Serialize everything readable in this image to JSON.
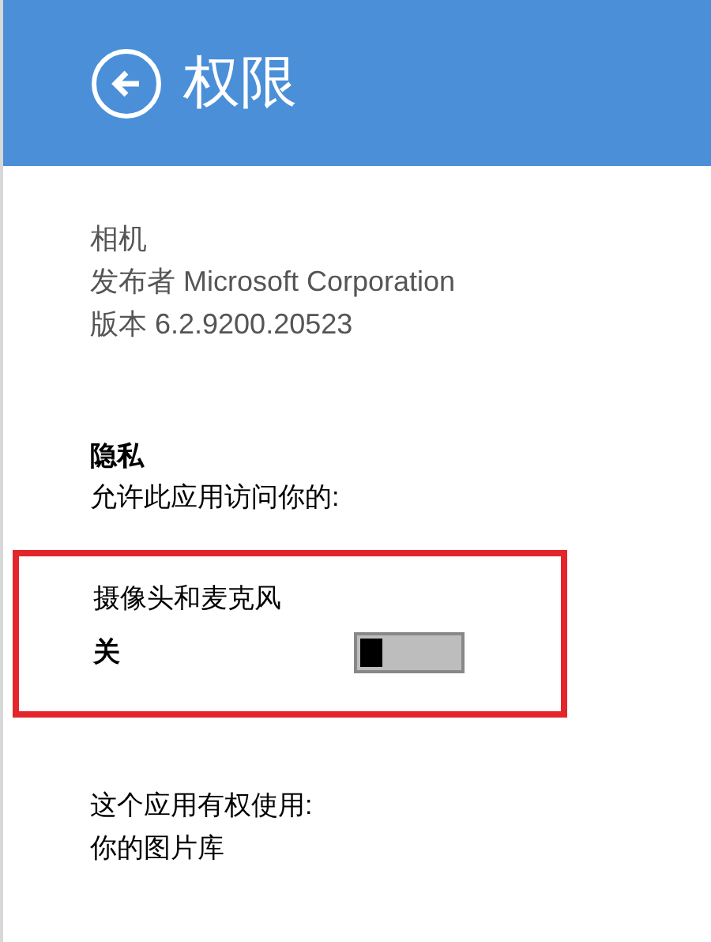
{
  "header": {
    "title": "权限"
  },
  "app": {
    "name": "相机",
    "publisher": "发布者 Microsoft Corporation",
    "version": "版本 6.2.9200.20523"
  },
  "privacy": {
    "heading": "隐私",
    "description": "允许此应用访问你的:"
  },
  "permission": {
    "highlighted": true,
    "label": "摄像头和麦克风",
    "state_text": "关",
    "on": false
  },
  "capabilities": {
    "heading": "这个应用有权使用:",
    "items": [
      "你的图片库"
    ]
  }
}
